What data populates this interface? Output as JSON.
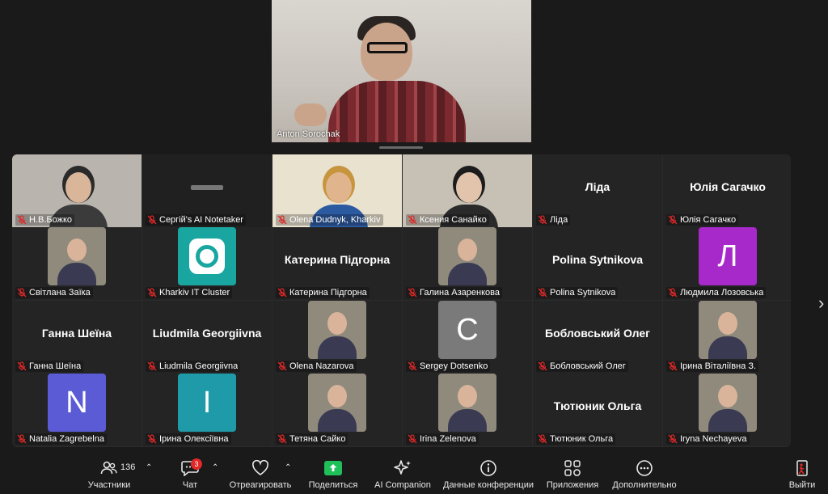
{
  "speaker": {
    "name": "Anton Sorochak"
  },
  "gallery": {
    "tiles": [
      {
        "name": "Н.В.Божко"
      },
      {
        "name": "Сергій's AI Notetaker"
      },
      {
        "name": "Olena Dudnyk, Kharkiv"
      },
      {
        "name": "Ксения Санайко"
      },
      {
        "name": "Ліда",
        "big": "Ліда"
      },
      {
        "name": "Юлія Сагачко",
        "big": "Юлія Сагачко"
      },
      {
        "name": "Світлана Заїка"
      },
      {
        "name": "Kharkiv IT Cluster"
      },
      {
        "name": "Катерина Підгорна",
        "big": "Катерина Підгорна"
      },
      {
        "name": "Галина Азаренкова"
      },
      {
        "name": "Polina Sytnikova",
        "big": "Polina Sytnikova"
      },
      {
        "name": "Людмила Лозовська",
        "letter": "Л"
      },
      {
        "name": "Ганна Шеїна",
        "big": "Ганна Шеїна"
      },
      {
        "name": "Liudmila Georgiivna",
        "big": "Liudmila Georgiivna"
      },
      {
        "name": "Olena Nazarova"
      },
      {
        "name": "Sergey Dotsenko",
        "letter": "C"
      },
      {
        "name": "Бобловський Олег",
        "big": "Бобловський Олег"
      },
      {
        "name": "Ірина Віталіївна З."
      },
      {
        "name": "Natalia Zagrebelna",
        "letter": "N"
      },
      {
        "name": "Ірина Олексіївна",
        "letter": "I"
      },
      {
        "name": "Тетяна Сайко"
      },
      {
        "name": "Irina Zelenova"
      },
      {
        "name": "Тютюник Ольга",
        "big": "Тютюник Ольга"
      },
      {
        "name": "Iryna Nechayeva"
      }
    ]
  },
  "toolbar": {
    "participants_label": "Участники",
    "participants_count": "136",
    "chat_label": "Чат",
    "chat_badge": "3",
    "react_label": "Отреагировать",
    "share_label": "Поделиться",
    "ai_label": "AI Companion",
    "info_label": "Данные конференции",
    "apps_label": "Приложения",
    "more_label": "Дополнительно",
    "leave_label": "Выйти"
  },
  "colors": {
    "accent_green": "#1fbf5a",
    "mic_muted": "#e02828",
    "leave_red": "#e02828"
  }
}
